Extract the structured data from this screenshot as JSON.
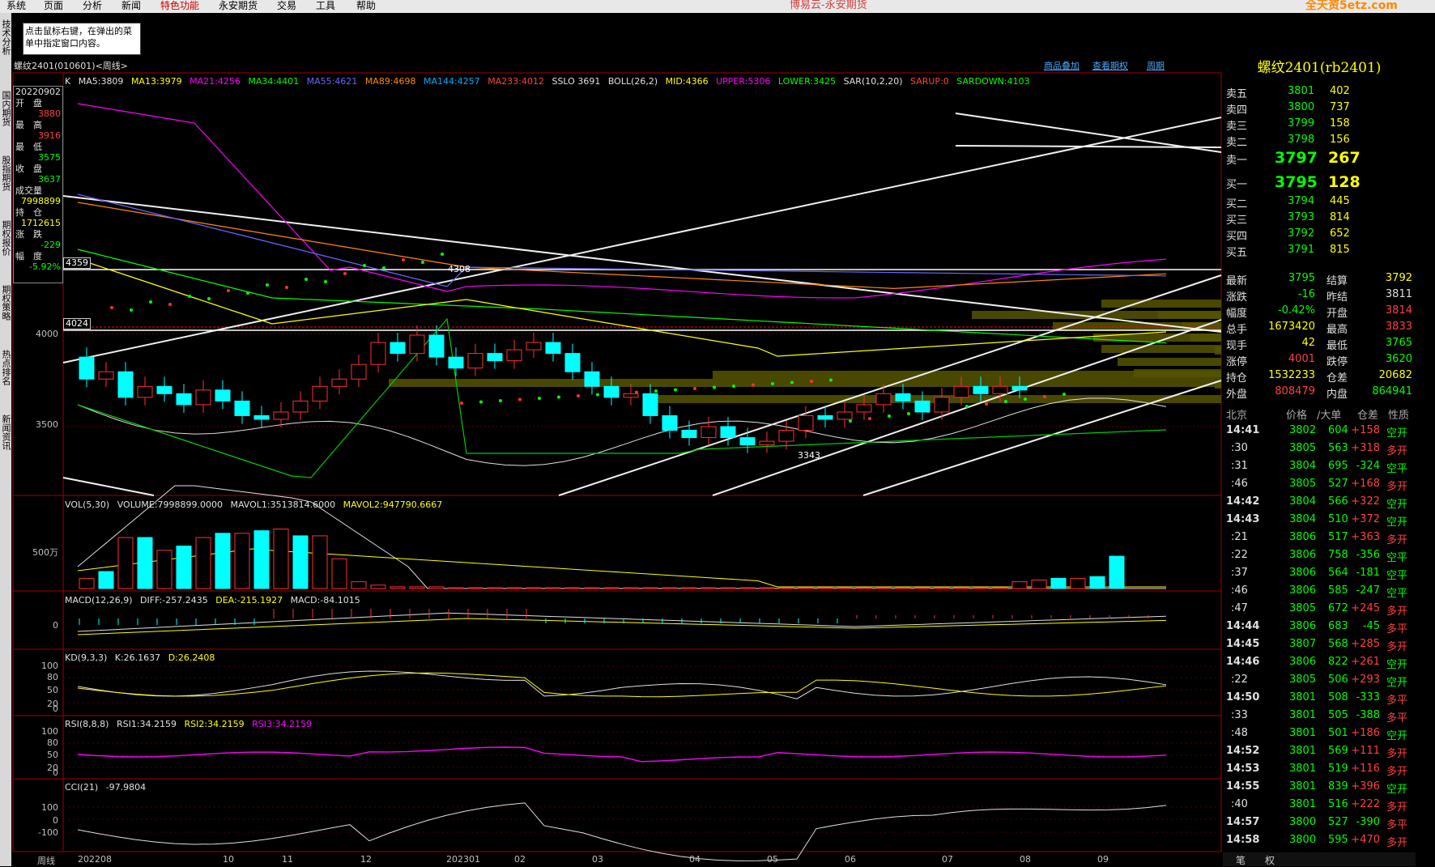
{
  "menu": {
    "items": [
      "系统",
      "页面",
      "分析",
      "新闻",
      "特色功能",
      "永安期货",
      "交易",
      "工具",
      "帮助"
    ],
    "app_title": "博易云-永安期货",
    "logo": "全天资5etz.com"
  },
  "tip": "点击鼠标右键，在弹出的菜单中指定窗口内容。",
  "leftbar": [
    "技术分析",
    "国内期货",
    "股指期货",
    "期权报价",
    "期权策略",
    "热点排名",
    "新闻资讯"
  ],
  "chart_title": "螺纹2401(010601)<周线>",
  "top_links": [
    "商品叠加",
    "查看期权",
    "周期"
  ],
  "info": {
    "date": "20220902",
    "open_lbl": "开　盘",
    "open": "3880",
    "high_lbl": "最　高",
    "high": "3916",
    "low_lbl": "最　低",
    "low": "3575",
    "close_lbl": "收　盘",
    "close": "3637",
    "vol_lbl": "成交量",
    "vol": "7998899",
    "oi_lbl": "持　仓",
    "oi": "1712615",
    "chg_lbl": "涨　跌",
    "chg": "-229",
    "pct_lbl": "幅　度",
    "pct": "-5.92%"
  },
  "main_ind": {
    "k": "K",
    "ma5": "MA5:3809",
    "ma13": "MA13:3979",
    "ma21": "MA21:4256",
    "ma34": "MA34:4401",
    "ma55": "MA55:4621",
    "ma89": "MA89:4698",
    "ma144": "MA144:4257",
    "ma233": "MA233:4012",
    "sslo": "SSLO 3691",
    "boll": "BOLL(26,2)",
    "mid": "MID:4366",
    "upper": "UPPER:5306",
    "lower": "LOWER:3425",
    "sar": "SAR(10,2,20)",
    "sarup": "SARUP:0",
    "sardown": "SARDOWN:4103"
  },
  "price_axis": [
    "4000",
    "3500"
  ],
  "price_boxes": {
    "b1": "4359",
    "b2": "4024"
  },
  "annot": {
    "hi": "4308",
    "lo": "3343"
  },
  "vol_ind": {
    "a": "VOL(5,30)",
    "b": "VOLUME:7998899.0000",
    "c": "MAVOL1:3513814.6000",
    "d": "MAVOL2:947790.6667",
    "axis": "500万"
  },
  "macd_ind": {
    "a": "MACD(12,26,9)",
    "b": "DIFF:-257.2435",
    "c": "DEA:-215.1927",
    "d": "MACD:-84.1015",
    "axis": "0"
  },
  "kd_ind": {
    "a": "KD(9,3,3)",
    "b": "K:26.1637",
    "c": "D:26.2408",
    "axis": [
      "100",
      "80",
      "50",
      "20",
      "0"
    ]
  },
  "rsi_ind": {
    "a": "RSI(8,8,8)",
    "b": "RSI1:34.2159",
    "c": "RSI2:34.2159",
    "d": "RSI3:34.2159",
    "axis": [
      "100",
      "80",
      "50",
      "20",
      "0"
    ]
  },
  "cci_ind": {
    "a": "CCI(21)",
    "b": "-97.9804",
    "axis": [
      "100",
      "0",
      "-100"
    ]
  },
  "x_axis": {
    "period": "周线",
    "ticks": [
      "202208",
      "10",
      "11",
      "12",
      "202301",
      "02",
      "03",
      "04",
      "05",
      "06",
      "07",
      "08",
      "09"
    ]
  },
  "panel": {
    "title": "螺纹2401(rb2401)",
    "asks": [
      [
        "卖五",
        "3801",
        "402"
      ],
      [
        "卖四",
        "3800",
        "737"
      ],
      [
        "卖三",
        "3799",
        "158"
      ],
      [
        "卖二",
        "3798",
        "156"
      ],
      [
        "卖一",
        "3797",
        "267"
      ]
    ],
    "bids": [
      [
        "买一",
        "3795",
        "128"
      ],
      [
        "买二",
        "3794",
        "445"
      ],
      [
        "买三",
        "3793",
        "814"
      ],
      [
        "买四",
        "3792",
        "652"
      ],
      [
        "买五",
        "3791",
        "815"
      ]
    ],
    "stats": [
      [
        "最新",
        "3795",
        "结算",
        "3792"
      ],
      [
        "涨跌",
        "-16",
        "昨结",
        "3811"
      ],
      [
        "幅度",
        "-0.42%",
        "开盘",
        "3814"
      ],
      [
        "总手",
        "1673420",
        "最高",
        "3833"
      ],
      [
        "现手",
        "42",
        "最低",
        "3765"
      ],
      [
        "涨停",
        "4001",
        "跌停",
        "3620"
      ],
      [
        "持仓",
        "1532233",
        "仓差",
        "20682"
      ],
      [
        "外盘",
        "808479",
        "内盘",
        "864941"
      ]
    ],
    "tick_header": [
      "北京",
      "价格",
      "∕大单",
      "仓差",
      "性质"
    ],
    "ticks": [
      [
        "14:41",
        "3802",
        "604",
        "+158",
        "空开"
      ],
      [
        ":30",
        "3805",
        "563",
        "+318",
        "多开"
      ],
      [
        ":31",
        "3804",
        "695",
        "-324",
        "空平"
      ],
      [
        ":46",
        "3805",
        "527",
        "+168",
        "多开"
      ],
      [
        "14:42",
        "3804",
        "566",
        "+322",
        "空开"
      ],
      [
        "14:43",
        "3804",
        "510",
        "+372",
        "空开"
      ],
      [
        ":21",
        "3806",
        "517",
        "+363",
        "多开"
      ],
      [
        ":22",
        "3806",
        "758",
        "-356",
        "空平"
      ],
      [
        ":37",
        "3806",
        "564",
        "-181",
        "空平"
      ],
      [
        ":46",
        "3806",
        "585",
        "-247",
        "空平"
      ],
      [
        ":47",
        "3805",
        "672",
        "+245",
        "多开"
      ],
      [
        "14:44",
        "3806",
        "683",
        "-45",
        "多平"
      ],
      [
        "14:45",
        "3807",
        "568",
        "+285",
        "多开"
      ],
      [
        "14:46",
        "3806",
        "822",
        "+261",
        "空开"
      ],
      [
        ":22",
        "3805",
        "506",
        "+293",
        "空开"
      ],
      [
        "14:50",
        "3801",
        "508",
        "-333",
        "多平"
      ],
      [
        ":33",
        "3801",
        "505",
        "-388",
        "多平"
      ],
      [
        ":48",
        "3801",
        "501",
        "+186",
        "空开"
      ],
      [
        "14:52",
        "3801",
        "569",
        "+111",
        "多开"
      ],
      [
        "14:53",
        "3801",
        "519",
        "+116",
        "多开"
      ],
      [
        "14:55",
        "3801",
        "839",
        "+396",
        "空开"
      ],
      [
        ":40",
        "3801",
        "516",
        "+222",
        "多开"
      ],
      [
        "14:57",
        "3800",
        "527",
        "-390",
        "多平"
      ],
      [
        "14:58",
        "3800",
        "595",
        "+470",
        "多开"
      ]
    ],
    "tabs": [
      "笔",
      "权"
    ]
  },
  "colors": {
    "up": "#ff3030",
    "down": "#00ffff",
    "ma5": "#e0e0e0",
    "ma13": "#ffff00",
    "ma21": "#ff00ff",
    "ma34": "#00ff00",
    "ma55": "#6666ff",
    "ma89": "#ff8800",
    "ma144": "#00aaff",
    "ma233": "#ff3030"
  }
}
